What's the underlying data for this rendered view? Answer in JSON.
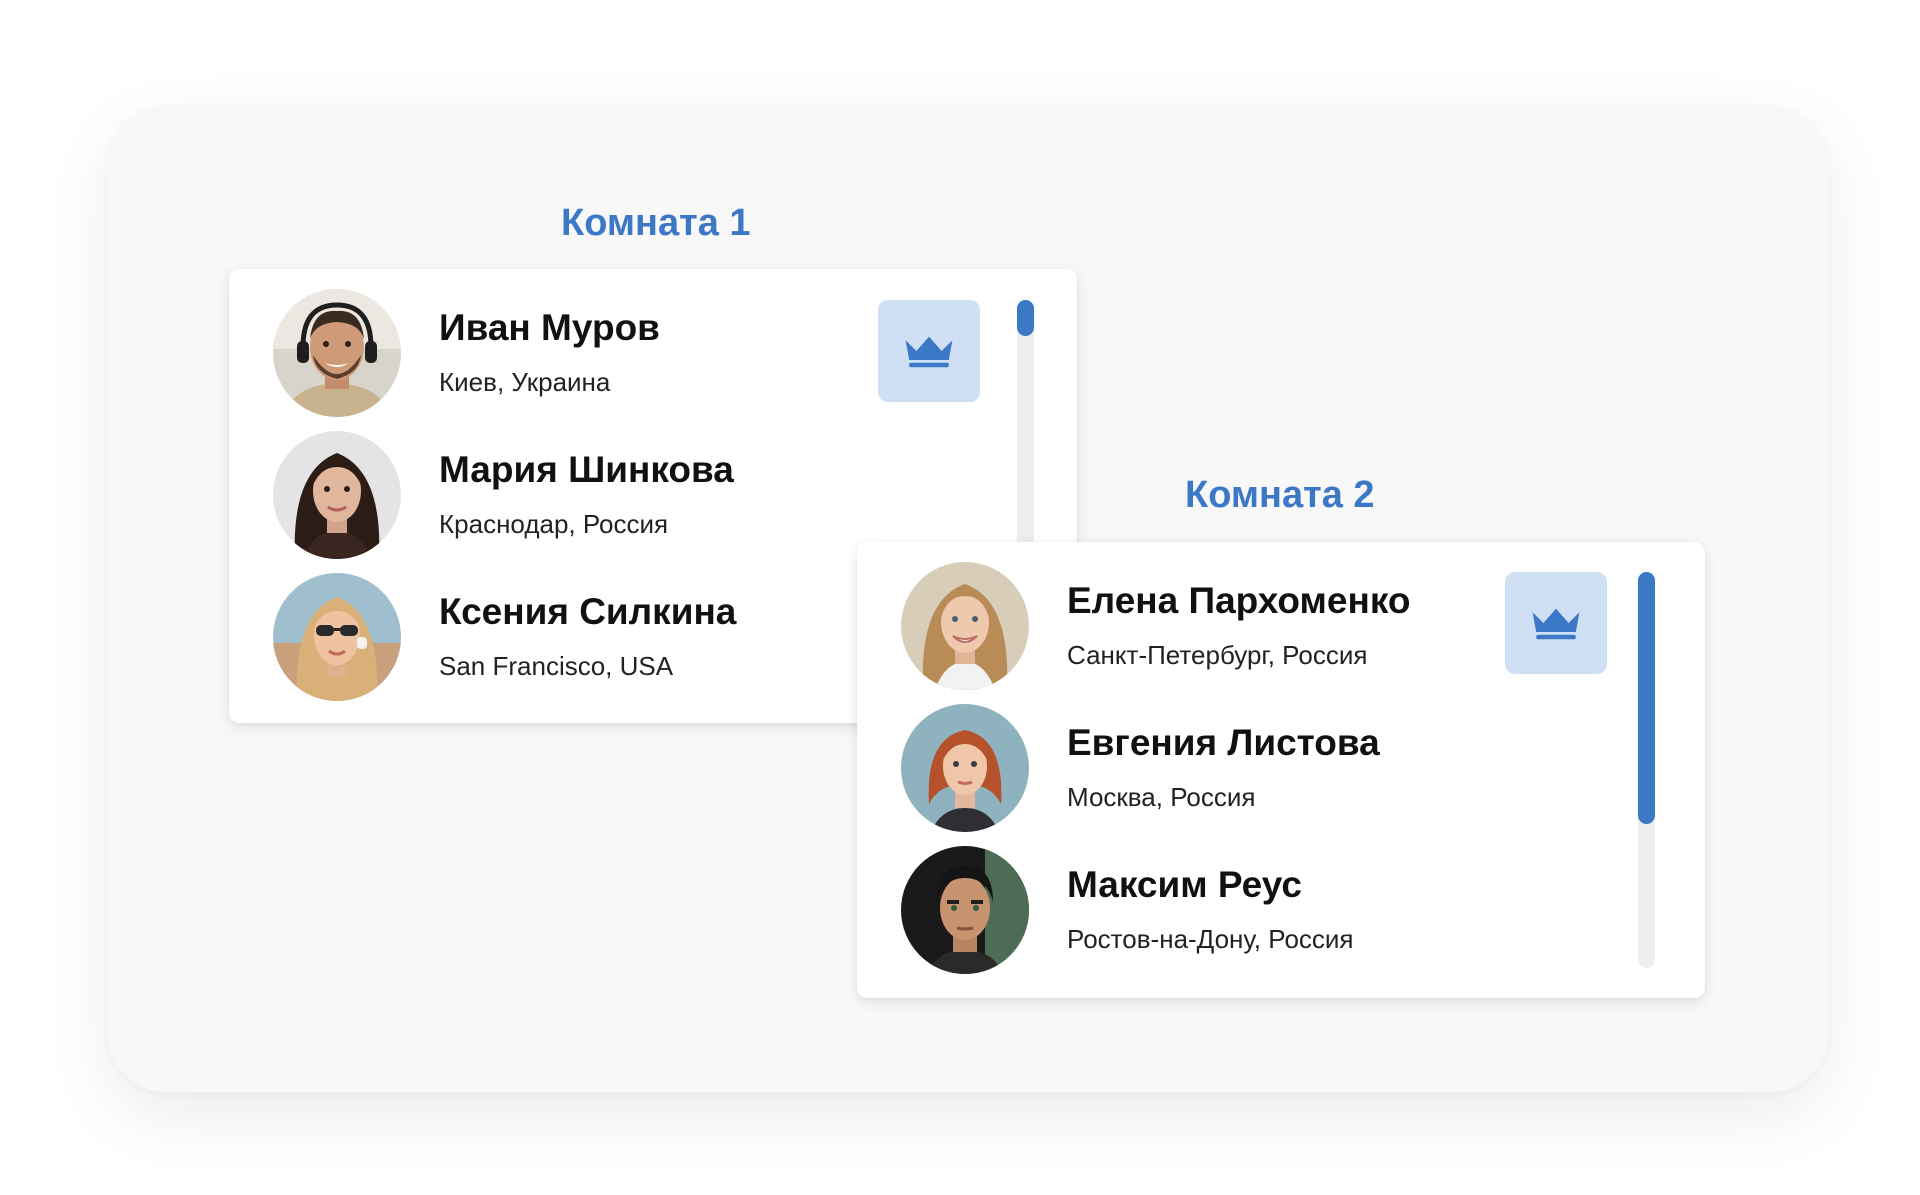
{
  "accent_color": "#3b78c6",
  "owner_button_bg": "#cfe0f4",
  "rooms": [
    {
      "title": "Комната 1",
      "owner_icon": "crown-icon",
      "members": [
        {
          "name": "Иван Муров",
          "city": "Киев, Украина",
          "avatar_icon": "avatar-man-headset"
        },
        {
          "name": "Мария Шинкова",
          "city": "Краснодар, Россия",
          "avatar_icon": "avatar-woman-dark-hair"
        },
        {
          "name": "Ксения Силкина",
          "city": "San Francisco, USA",
          "avatar_icon": "avatar-woman-sunglasses"
        }
      ]
    },
    {
      "title": "Комната 2",
      "owner_icon": "crown-icon",
      "members": [
        {
          "name": "Елена Пархоменко",
          "city": "Санкт-Петербург, Россия",
          "avatar_icon": "avatar-woman-blonde"
        },
        {
          "name": "Евгения Листова",
          "city": "Москва, Россия",
          "avatar_icon": "avatar-woman-red-bob"
        },
        {
          "name": "Максим Реус",
          "city": "Ростов-на-Дону, Россия",
          "avatar_icon": "avatar-man-dark-hair"
        }
      ]
    }
  ]
}
